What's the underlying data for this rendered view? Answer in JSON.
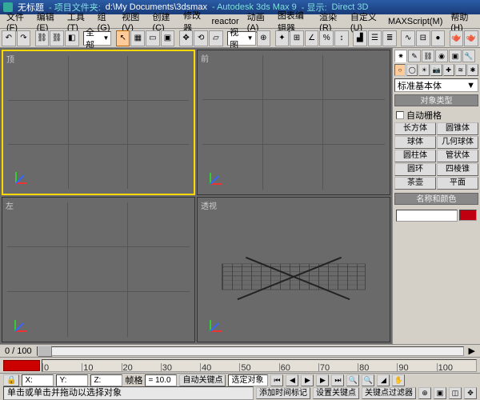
{
  "title": {
    "untitled": "无标题",
    "projlabel": "项目文件夹:",
    "projpath": "d:\\My Documents\\3dsmax",
    "app": "Autodesk 3ds Max 9",
    "displabel": "显示:",
    "driver": "Direct 3D"
  },
  "menu": [
    "文件(F)",
    "编辑(E)",
    "工具(T)",
    "组(G)",
    "视图(V)",
    "创建(C)",
    "修改器",
    "reactor",
    "动画(A)",
    "图表编辑器",
    "渲染(R)",
    "自定义(U)",
    "MAXScript(M)",
    "帮助(H)"
  ],
  "toolbar": {
    "combo1": "全部",
    "combo2": "视图"
  },
  "viewports": {
    "top": "顶",
    "front": "前",
    "left": "左",
    "persp": "透视"
  },
  "panel": {
    "primitives_combo": "标准基本体",
    "rollout_type": "对象类型",
    "autogrid": "自动栅格",
    "objects": [
      "长方体",
      "圆锥体",
      "球体",
      "几何球体",
      "圆柱体",
      "管状体",
      "圆环",
      "四棱锥",
      "茶壶",
      "平面"
    ],
    "rollout_name": "名称和颜色",
    "swatch": "#c00010"
  },
  "timeline": {
    "pos": "0 / 100",
    "ticks": [
      0,
      10,
      20,
      30,
      40,
      50,
      60,
      70,
      80,
      90,
      100
    ]
  },
  "status": {
    "prompt": "单击或单击并拖动以选择对象",
    "addkey": "添加时间标记",
    "frame_label": "帧格",
    "frame_val": "= 10.0",
    "autokey": "自动关键点",
    "selected": "选定对象",
    "setkey": "设置关键点",
    "keyfilter": "关键点过滤器"
  }
}
